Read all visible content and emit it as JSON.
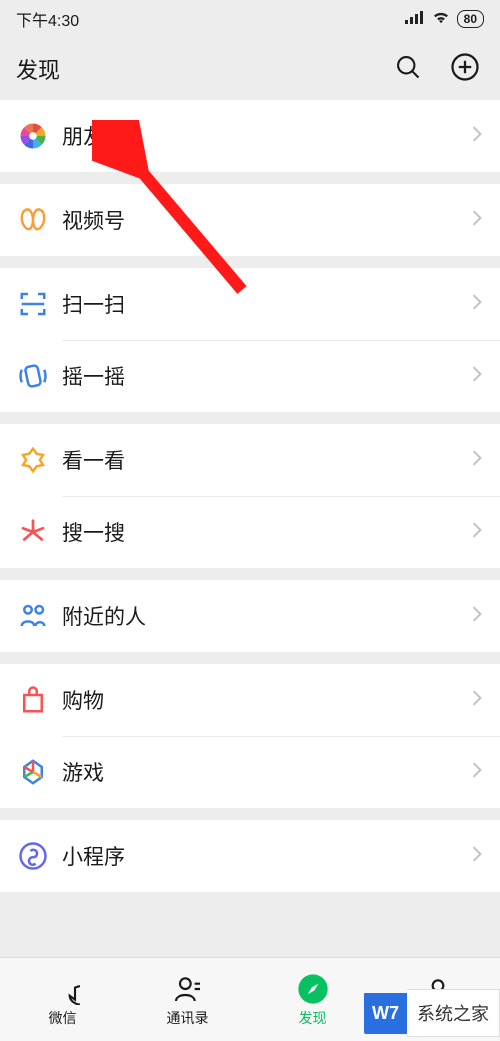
{
  "status": {
    "time": "下午4:30",
    "battery": "80"
  },
  "header": {
    "title": "发现"
  },
  "rows": {
    "moments": "朋友圈",
    "channels": "视频号",
    "scan": "扫一扫",
    "shake": "摇一摇",
    "topStories": "看一看",
    "search": "搜一搜",
    "nearby": "附近的人",
    "shopping": "购物",
    "games": "游戏",
    "miniprograms": "小程序"
  },
  "tabs": {
    "chats": "微信",
    "contacts": "通讯录",
    "discover": "发现"
  },
  "watermark": {
    "left": "W7",
    "right": "系统之家"
  }
}
